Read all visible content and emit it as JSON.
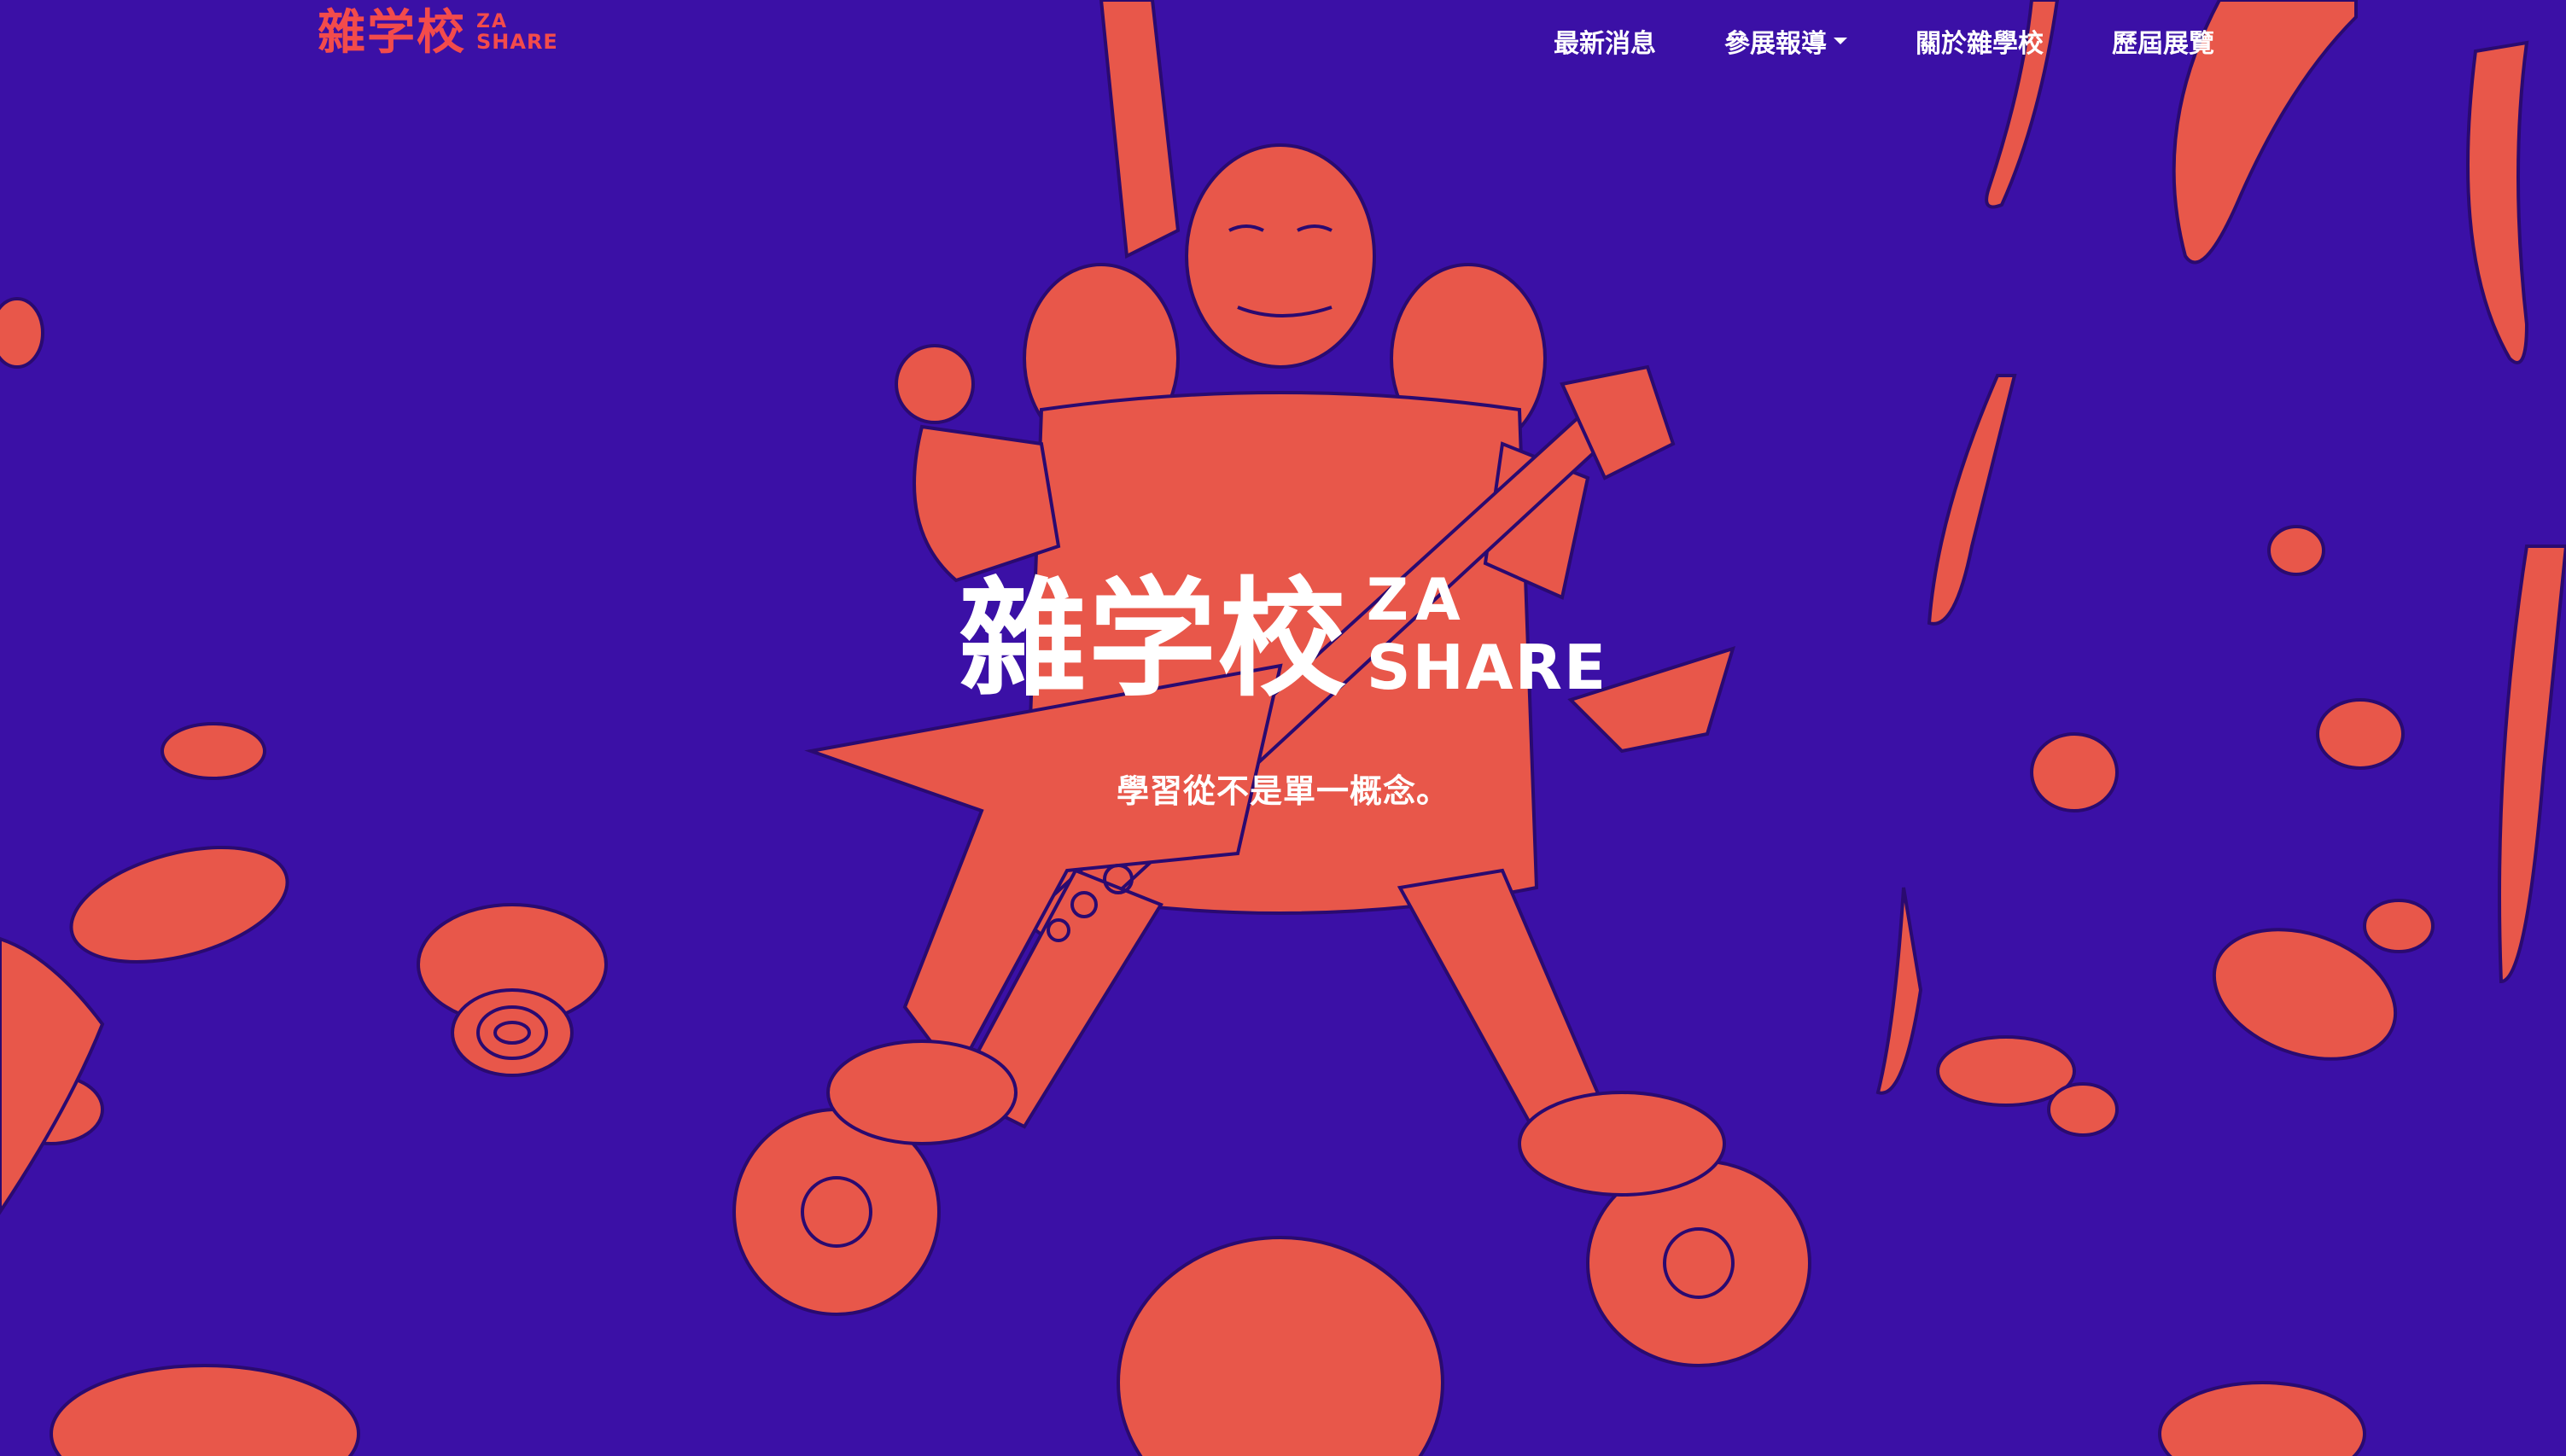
{
  "brand": {
    "kanji": "雜学校",
    "latin_line1": "ZA",
    "latin_line2": "SHARE"
  },
  "nav": {
    "items": [
      {
        "label": "最新消息"
      },
      {
        "label": "參展報導"
      },
      {
        "label": "關於雜學校"
      },
      {
        "label": "歷屆展覽"
      }
    ]
  },
  "hero": {
    "kanji": "雜学校",
    "latin_line1": "ZA",
    "latin_line2": "SHARE",
    "tagline": "學習從不是單一概念。"
  },
  "colors": {
    "background": "#3b10a6",
    "illustration": "#e8574a",
    "brand": "#f34b4b",
    "text": "#ffffff"
  }
}
